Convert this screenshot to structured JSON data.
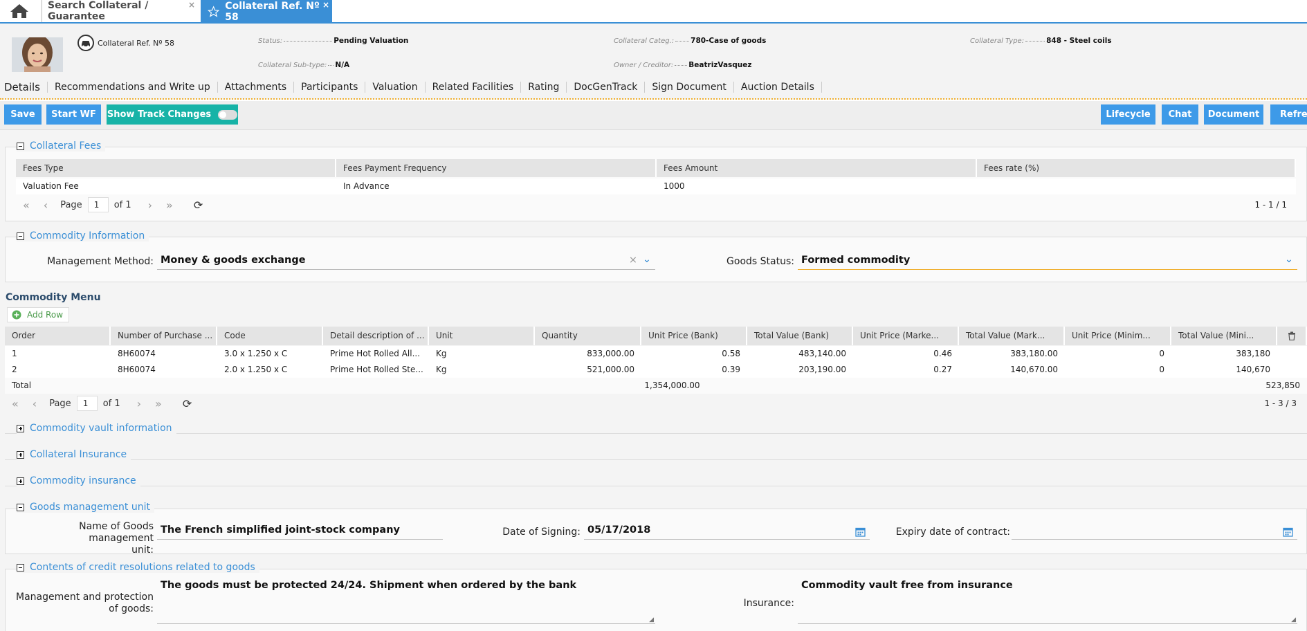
{
  "tabs": {
    "home_icon": "home-icon",
    "search_tab": "Search Collateral / Guarantee",
    "active_tab": "Collateral Ref. Nº 58",
    "close": "×"
  },
  "header": {
    "ref": "Collateral Ref. Nº 58",
    "status_label": "Status:",
    "status_value": "Pending Valuation",
    "subtype_label": "Collateral Sub-type:",
    "subtype_value": "N/A",
    "categ_label": "Collateral Categ.:",
    "categ_value": "780-Case of goods",
    "owner_label": "Owner / Creditor:",
    "owner_value": "BeatrizVasquez",
    "type_label": "Collateral Type:",
    "type_value": "848 - Steel coils"
  },
  "subtabs": [
    "Details",
    "Recommendations and Write up",
    "Attachments",
    "Participants",
    "Valuation",
    "Related Facilities",
    "Rating",
    "DocGenTrack",
    "Sign Document",
    "Auction Details"
  ],
  "toolbar": {
    "save": "Save",
    "start_wf": "Start WF",
    "track_changes": "Show Track Changes",
    "lifecycle": "Lifecycle",
    "chat": "Chat",
    "document": "Document",
    "refresh": "Refres"
  },
  "fees": {
    "title": "Collateral Fees",
    "columns": [
      "Fees Type",
      "Fees Payment Frequency",
      "Fees Amount",
      "Fees rate (%)"
    ],
    "rows": [
      [
        "Valuation Fee",
        "In Advance",
        "1000",
        ""
      ]
    ],
    "page_label": "Page",
    "page": "1",
    "of": "of 1",
    "range": "1 - 1 / 1"
  },
  "commodity_info": {
    "title": "Commodity Information",
    "management_label": "Management Method:",
    "management_value": "Money & goods exchange",
    "goods_status_label": "Goods Status:",
    "goods_status_value": "Formed commodity"
  },
  "commodity_menu": {
    "title": "Commodity Menu",
    "add_row": "Add Row",
    "columns": [
      "Order",
      "Number of Purchase ...",
      "Code",
      "Detail description of ...",
      "Unit",
      "Quantity",
      "Unit Price (Bank)",
      "Total Value (Bank)",
      "Unit Price (Marke...",
      "Total Value (Mark...",
      "Unit Price (Minim...",
      "Total Value (Mini..."
    ],
    "rows": [
      [
        "1",
        "8H60074",
        "3.0 x 1.250 x C",
        "Prime Hot Rolled All...",
        "Kg",
        "833,000.00",
        "0.58",
        "483,140.00",
        "0.46",
        "383,180.00",
        "0",
        "383,180"
      ],
      [
        "2",
        "8H60074",
        "2.0 x 1.250 x C",
        "Prime Hot Rolled Ste...",
        "Kg",
        "521,000.00",
        "0.39",
        "203,190.00",
        "0.27",
        "140,670.00",
        "0",
        "140,670"
      ]
    ],
    "total_label": "Total",
    "total_quantity": "1,354,000.00",
    "total_min": "523,850",
    "page_label": "Page",
    "page": "1",
    "of": "of 1",
    "range": "1 - 3 / 3"
  },
  "collapsed_sections": [
    "Commodity vault information",
    "Collateral Insurance",
    "Commodity insurance"
  ],
  "goods_unit": {
    "title": "Goods management unit",
    "name_label_1": "Name of Goods management",
    "name_label_2": "unit:",
    "name_value": "The French simplified joint-stock company",
    "date_label": "Date of Signing:",
    "date_value": "05/17/2018",
    "expiry_label": "Expiry date of contract:",
    "expiry_value": ""
  },
  "credit": {
    "title": "Contents of credit resolutions related to goods",
    "mgmt_label_1": "Management and protection",
    "mgmt_label_2": "of goods:",
    "mgmt_value": "The goods must be protected 24/24. Shipment when ordered by the bank",
    "insurance_label": "Insurance:",
    "insurance_value": "Commodity vault free from insurance"
  }
}
